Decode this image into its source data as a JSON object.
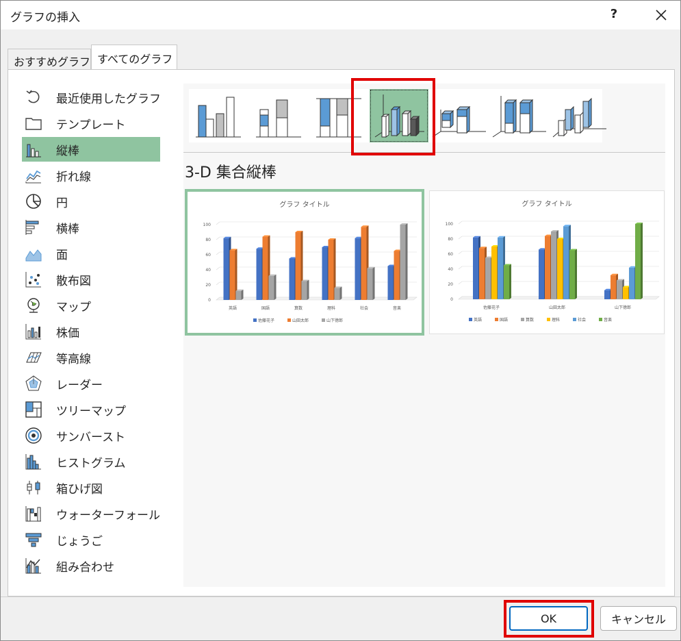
{
  "window": {
    "title": "グラフの挿入",
    "help": "?"
  },
  "tabs": [
    {
      "label": "おすすめグラフ",
      "active": false
    },
    {
      "label": "すべてのグラフ",
      "active": true
    }
  ],
  "sidebar": {
    "items": [
      {
        "label": "最近使用したグラフ",
        "icon": "recent-icon"
      },
      {
        "label": "テンプレート",
        "icon": "folder-icon"
      },
      {
        "label": "縦棒",
        "icon": "column-chart-icon",
        "selected": true
      },
      {
        "label": "折れ線",
        "icon": "line-chart-icon"
      },
      {
        "label": "円",
        "icon": "pie-chart-icon"
      },
      {
        "label": "横棒",
        "icon": "bar-chart-icon"
      },
      {
        "label": "面",
        "icon": "area-chart-icon"
      },
      {
        "label": "散布図",
        "icon": "scatter-chart-icon"
      },
      {
        "label": "マップ",
        "icon": "map-chart-icon"
      },
      {
        "label": "株価",
        "icon": "stock-chart-icon"
      },
      {
        "label": "等高線",
        "icon": "surface-chart-icon"
      },
      {
        "label": "レーダー",
        "icon": "radar-chart-icon"
      },
      {
        "label": "ツリーマップ",
        "icon": "treemap-chart-icon"
      },
      {
        "label": "サンバースト",
        "icon": "sunburst-chart-icon"
      },
      {
        "label": "ヒストグラム",
        "icon": "histogram-chart-icon"
      },
      {
        "label": "箱ひげ図",
        "icon": "boxplot-chart-icon"
      },
      {
        "label": "ウォーターフォール",
        "icon": "waterfall-chart-icon"
      },
      {
        "label": "じょうご",
        "icon": "funnel-chart-icon"
      },
      {
        "label": "組み合わせ",
        "icon": "combo-chart-icon"
      }
    ]
  },
  "gallery": {
    "selected_index": 3,
    "items": [
      "clustered-column",
      "stacked-column",
      "100-stacked-column",
      "3d-clustered-column",
      "3d-stacked-column",
      "3d-100-stacked-column",
      "3d-column"
    ]
  },
  "chart_type_title": "3-D 集合縦棒",
  "previews": {
    "p1": {
      "title": "グラフ タイトル",
      "y_ticks": [
        "0",
        "20",
        "40",
        "60",
        "80",
        "100"
      ],
      "categories": [
        "英語",
        "国語",
        "算数",
        "理科",
        "社会",
        "音楽"
      ],
      "legend": [
        "佐藤花子",
        "山田太郎",
        "山下徳郎"
      ]
    },
    "p2": {
      "title": "グラフ タイトル",
      "y_ticks": [
        "0",
        "20",
        "40",
        "60",
        "80",
        "100"
      ],
      "categories": [
        "佐藤花子",
        "山田太郎",
        "山下徳郎"
      ],
      "legend": [
        "英語",
        "国語",
        "算数",
        "理科",
        "社会",
        "音楽"
      ]
    }
  },
  "chart_data": [
    {
      "type": "bar",
      "title": "グラフ タイトル",
      "categories": [
        "英語",
        "国語",
        "算数",
        "理科",
        "社会",
        "音楽"
      ],
      "ylim": [
        0,
        100
      ],
      "series": [
        {
          "name": "佐藤花子",
          "values": [
            82,
            68,
            55,
            70,
            82,
            45
          ]
        },
        {
          "name": "山田太郎",
          "values": [
            66,
            84,
            90,
            80,
            97,
            65
          ]
        },
        {
          "name": "山下徳郎",
          "values": [
            12,
            32,
            25,
            16,
            42,
            100
          ]
        }
      ],
      "colors": [
        "#4472c4",
        "#ed7d31",
        "#a5a5a5"
      ],
      "legend": "bottom"
    },
    {
      "type": "bar",
      "title": "グラフ タイトル",
      "categories": [
        "佐藤花子",
        "山田太郎",
        "山下徳郎"
      ],
      "ylim": [
        0,
        100
      ],
      "series": [
        {
          "name": "英語",
          "values": [
            82,
            66,
            12
          ]
        },
        {
          "name": "国語",
          "values": [
            68,
            84,
            32
          ]
        },
        {
          "name": "算数",
          "values": [
            55,
            90,
            25
          ]
        },
        {
          "name": "理科",
          "values": [
            70,
            80,
            16
          ]
        },
        {
          "name": "社会",
          "values": [
            82,
            97,
            42
          ]
        },
        {
          "name": "音楽",
          "values": [
            45,
            65,
            100
          ]
        }
      ],
      "colors": [
        "#4472c4",
        "#ed7d31",
        "#a5a5a5",
        "#ffc000",
        "#5b9bd5",
        "#70ad47"
      ],
      "legend": "bottom"
    }
  ],
  "buttons": {
    "ok": "OK",
    "cancel": "キャンセル"
  }
}
